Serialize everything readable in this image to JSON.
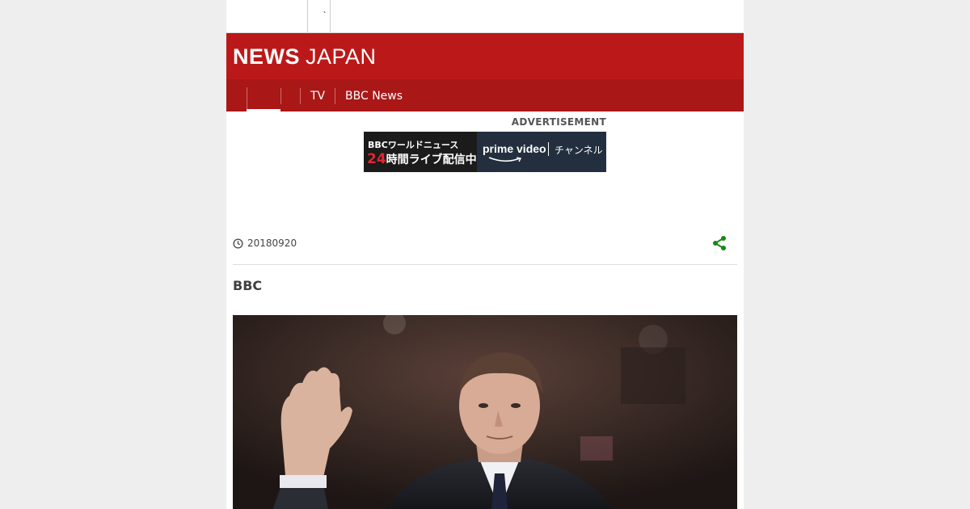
{
  "header": {
    "logo_primary": "NEWS",
    "logo_secondary": "JAPAN",
    "brand_color": "#bb1919"
  },
  "nav": {
    "items": [
      {
        "label": "TV"
      },
      {
        "label": "BBC News"
      }
    ]
  },
  "advert": {
    "label": "ADVERTISEMENT",
    "line1": "BBCワールドニュース",
    "line2_number": "24",
    "line2_text": "時間ライブ配信中",
    "service": "prime video",
    "channel": "チャンネル"
  },
  "article": {
    "date": "20180920",
    "byline": "BBC",
    "share_color": "#178a16"
  }
}
